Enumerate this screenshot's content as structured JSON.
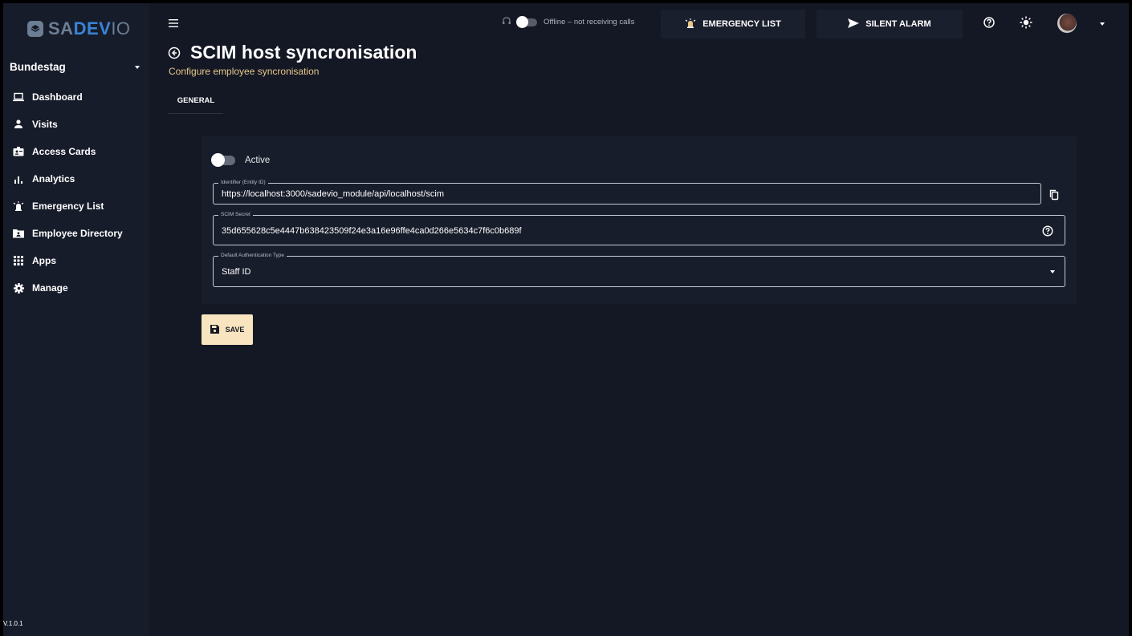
{
  "brand": {
    "logo_text_1": "SA",
    "logo_text_2": "DEV",
    "logo_text_3": "IO"
  },
  "sidebar": {
    "org": "Bundestag",
    "items": [
      {
        "label": "Dashboard",
        "icon": "laptop-icon"
      },
      {
        "label": "Visits",
        "icon": "person-icon"
      },
      {
        "label": "Access Cards",
        "icon": "badge-icon"
      },
      {
        "label": "Analytics",
        "icon": "bar-chart-icon"
      },
      {
        "label": "Emergency List",
        "icon": "alarm-icon"
      },
      {
        "label": "Employee Directory",
        "icon": "folder-account-icon"
      },
      {
        "label": "Apps",
        "icon": "grid-icon"
      },
      {
        "label": "Manage",
        "icon": "gear-icon"
      }
    ],
    "version": "V.1.0.1"
  },
  "topbar": {
    "status_text": "Offline – not receiving calls",
    "emergency_label": "EMERGENCY LIST",
    "silent_alarm_label": "SILENT ALARM"
  },
  "page": {
    "title": "SCIM host syncronisation",
    "subtitle": "Configure employee syncronisation",
    "tab": "GENERAL"
  },
  "form": {
    "active_label": "Active",
    "active": false,
    "identifier_label": "Identifier (Entity ID)",
    "identifier_value": "https://localhost:3000/sadevio_module/api/localhost/scim",
    "secret_label": "SCIM Secret",
    "secret_value": "35d655628c5e4447b638423509f24e3a16e96ffe4ca0d266e5634c7f6c0b689f",
    "auth_label": "Default Authentication Type",
    "auth_value": "Staff ID",
    "save_label": "SAVE"
  },
  "colors": {
    "background": "#141824",
    "panel": "#181d2b",
    "accent_button": "#f8e5c0",
    "subtitle": "#e6c88a",
    "brand_blue": "#3a84d6"
  }
}
